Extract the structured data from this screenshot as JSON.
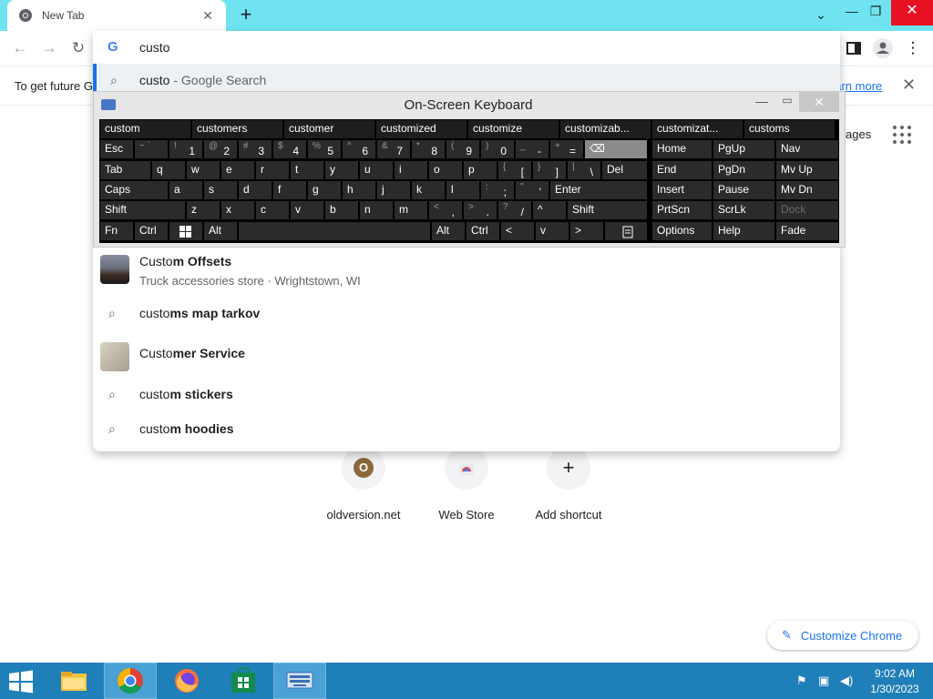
{
  "tab": {
    "title": "New Tab",
    "close": "✕"
  },
  "window": {
    "tablist": "⌄",
    "minimize": "—",
    "maximize": "❐",
    "close": "✕"
  },
  "toolbar": {
    "back": "←",
    "forward": "→",
    "reload": "↻",
    "menu": "⋮",
    "google_logo": "G"
  },
  "infobar": {
    "text": "To get future G",
    "link": "earn more",
    "close": "✕"
  },
  "ntp": {
    "images_link": "ages",
    "shortcuts": [
      {
        "label": "oldversion.net",
        "glyph": "O"
      },
      {
        "label": "Web Store",
        "glyph": ""
      },
      {
        "label": "Add shortcut",
        "glyph": "+"
      }
    ],
    "customize": "Customize Chrome"
  },
  "omnibox": {
    "input": "custo",
    "selected": {
      "typed": "custo",
      "suffix": " - Google Search"
    },
    "suggestions": [
      {
        "typed": "Custo",
        "completion": "m Offsets",
        "sub": "Truck accessories store · Wrightstown, WI"
      },
      {
        "typed": "custo",
        "completion": "ms map tarkov"
      },
      {
        "typed": "Custo",
        "completion": "mer Service"
      },
      {
        "typed": "custo",
        "completion": "m stickers"
      },
      {
        "typed": "custo",
        "completion": "m hoodies"
      }
    ]
  },
  "osk": {
    "title": "On-Screen Keyboard",
    "close": "✕",
    "predictions": [
      "custom",
      "customers",
      "customer",
      "customized",
      "customize",
      "customizab...",
      "customizat...",
      "customs"
    ],
    "row1": [
      {
        "mn": "Esc",
        "sh": ""
      },
      {
        "mn": "",
        "sh": "~ `"
      },
      {
        "mn": "1",
        "sh": "!"
      },
      {
        "mn": "2",
        "sh": "@"
      },
      {
        "mn": "3",
        "sh": "#"
      },
      {
        "mn": "4",
        "sh": "$"
      },
      {
        "mn": "5",
        "sh": "%"
      },
      {
        "mn": "6",
        "sh": "^"
      },
      {
        "mn": "7",
        "sh": "&"
      },
      {
        "mn": "8",
        "sh": "*"
      },
      {
        "mn": "9",
        "sh": "("
      },
      {
        "mn": "0",
        "sh": ")"
      },
      {
        "mn": "-",
        "sh": "_"
      },
      {
        "mn": "=",
        "sh": "+"
      },
      {
        "mn": "⌫",
        "sh": ""
      }
    ],
    "row2": [
      "Tab",
      "q",
      "w",
      "e",
      "r",
      "t",
      "y",
      "u",
      "i",
      "o",
      "p",
      "[",
      "]",
      "\\",
      "Del"
    ],
    "row2_shift": [
      "",
      "",
      "",
      "",
      "",
      "",
      "",
      "",
      "",
      "",
      "",
      "{",
      "}",
      "|",
      ""
    ],
    "row3": [
      "Caps",
      "a",
      "s",
      "d",
      "f",
      "g",
      "h",
      "j",
      "k",
      "l",
      ";",
      "'",
      "Enter"
    ],
    "row3_shift": [
      "",
      "",
      "",
      "",
      "",
      "",
      "",
      "",
      "",
      "",
      ":",
      "\"",
      ""
    ],
    "row4": [
      "Shift",
      "z",
      "x",
      "c",
      "v",
      "b",
      "n",
      "m",
      ",",
      ".",
      "/",
      "^",
      "Shift"
    ],
    "row4_shift": [
      "",
      "",
      "",
      "",
      "",
      "",
      "",
      "",
      "<",
      ">",
      "?",
      "",
      ""
    ],
    "row5": [
      "Fn",
      "Ctrl",
      "",
      "Alt",
      "",
      "Alt",
      "Ctrl",
      "<",
      "v",
      ">",
      ""
    ],
    "nav": [
      [
        "Home",
        "PgUp",
        "Nav"
      ],
      [
        "End",
        "PgDn",
        "Mv Up"
      ],
      [
        "Insert",
        "Pause",
        "Mv Dn"
      ],
      [
        "PrtScn",
        "ScrLk",
        "Dock"
      ],
      [
        "Options",
        "Help",
        "Fade"
      ]
    ]
  },
  "taskbar": {
    "time": "9:02 AM",
    "date": "1/30/2023"
  }
}
